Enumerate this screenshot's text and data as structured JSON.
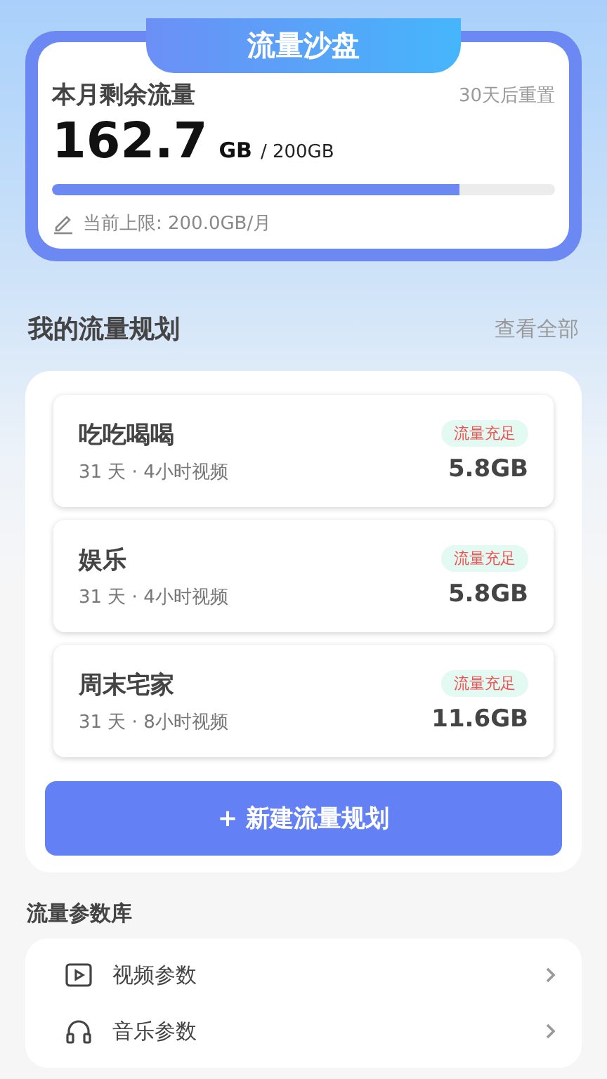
{
  "sandbox": {
    "title": "流量沙盘",
    "label": "本月剩余流量",
    "reset": "30天后重置",
    "amount": "162.7",
    "unit": "GB",
    "total": "/ 200GB",
    "level": 0.81,
    "limit": "当前上限: 200.0GB/月"
  },
  "plans_section": {
    "title": "我的流量规划",
    "link": "查看全部"
  },
  "plans": [
    {
      "name": "吃吃喝喝",
      "detail": "31 天 · 4小时视频",
      "badge": "流量充足",
      "size": "5.8GB"
    },
    {
      "name": "娱乐",
      "detail": "31 天 · 4小时视频",
      "badge": "流量充足",
      "size": "5.8GB"
    },
    {
      "name": "周末宅家",
      "detail": "31 天 · 8小时视频",
      "badge": "流量充足",
      "size": "11.6GB"
    }
  ],
  "new_plan_button": "+ 新建流量规划",
  "library": {
    "title": "流量参数库",
    "items": [
      {
        "kind": "video",
        "label": "视频参数"
      },
      {
        "kind": "music",
        "label": "音乐参数"
      }
    ]
  }
}
